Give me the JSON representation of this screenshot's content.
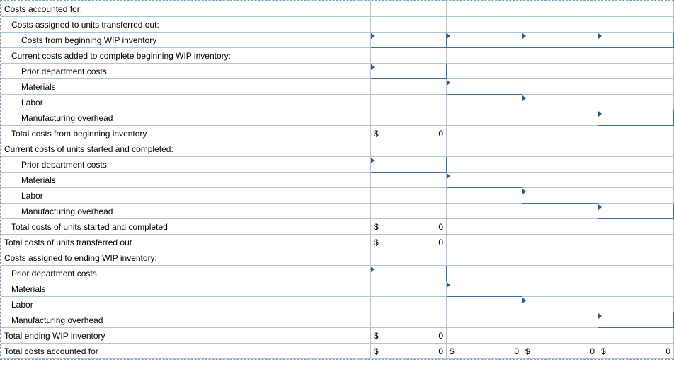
{
  "currency": "$",
  "zero": "0",
  "rows": [
    {
      "label": "Costs accounted for:",
      "indent": 0,
      "cells": [
        null,
        null,
        null,
        null
      ]
    },
    {
      "label": "Costs assigned to units transferred out:",
      "indent": 1,
      "cells": [
        null,
        null,
        null,
        null
      ]
    },
    {
      "label": "Costs from beginning WIP inventory",
      "indent": 2,
      "cells": [
        "in",
        "in",
        "in",
        "in"
      ]
    },
    {
      "label": "Current costs added to complete beginning WIP inventory:",
      "indent": 1,
      "cells": [
        null,
        null,
        null,
        null
      ]
    },
    {
      "label": "Prior department costs",
      "indent": 2,
      "cells": [
        "in-arrow",
        null,
        null,
        null
      ]
    },
    {
      "label": "Materials",
      "indent": 2,
      "cells": [
        null,
        "in-arrow",
        null,
        null
      ]
    },
    {
      "label": "Labor",
      "indent": 2,
      "cells": [
        null,
        null,
        "in-arrow",
        null
      ]
    },
    {
      "label": "Manufacturing overhead",
      "indent": 2,
      "cells": [
        null,
        null,
        null,
        "in-arrow"
      ]
    },
    {
      "label": "Total costs from beginning inventory",
      "indent": 1,
      "cells": [
        "calc0",
        null,
        null,
        null
      ]
    },
    {
      "label": "Current costs of units started and completed:",
      "indent": 0,
      "cells": [
        null,
        null,
        null,
        null
      ]
    },
    {
      "label": "Prior department costs",
      "indent": 2,
      "cells": [
        "in-arrow",
        null,
        null,
        null
      ]
    },
    {
      "label": "Materials",
      "indent": 2,
      "cells": [
        null,
        "in-arrow",
        null,
        null
      ]
    },
    {
      "label": "Labor",
      "indent": 2,
      "cells": [
        null,
        null,
        "in-arrow",
        null
      ]
    },
    {
      "label": "Manufacturing overhead",
      "indent": 2,
      "cells": [
        null,
        null,
        null,
        "in-arrow"
      ]
    },
    {
      "label": "Total costs of units started and completed",
      "indent": 1,
      "cells": [
        "calc0",
        null,
        null,
        null
      ]
    },
    {
      "label": "Total costs of units transferred out",
      "indent": 0,
      "cells": [
        "calc0",
        null,
        null,
        null
      ]
    },
    {
      "label": "Costs assigned to ending WIP inventory:",
      "indent": 0,
      "cells": [
        null,
        null,
        null,
        null
      ]
    },
    {
      "label": "Prior department costs",
      "indent": 1,
      "cells": [
        "in-arrow",
        null,
        null,
        null
      ]
    },
    {
      "label": "Materials",
      "indent": 1,
      "cells": [
        null,
        "in-arrow",
        null,
        null
      ]
    },
    {
      "label": "Labor",
      "indent": 1,
      "cells": [
        null,
        null,
        "in-arrow",
        null
      ]
    },
    {
      "label": "Manufacturing overhead",
      "indent": 1,
      "cells": [
        null,
        null,
        null,
        "in-arrow"
      ]
    },
    {
      "label": "Total ending WIP inventory",
      "indent": 0,
      "cells": [
        "calc0",
        null,
        null,
        null
      ]
    },
    {
      "label": "Total costs accounted for",
      "indent": 0,
      "cells": [
        "calc0",
        "calc0",
        "calc0",
        "calc0"
      ]
    }
  ]
}
